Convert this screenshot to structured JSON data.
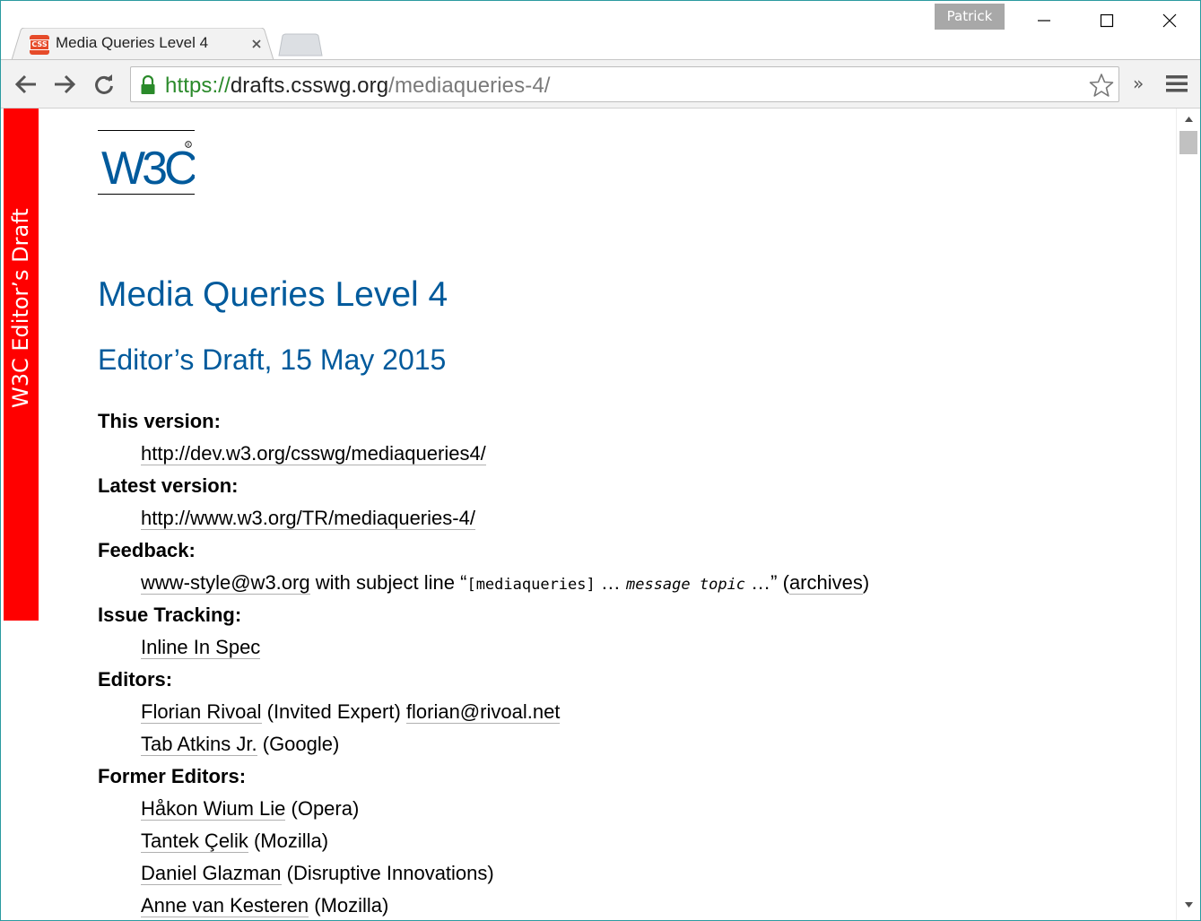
{
  "window": {
    "profile_name": "Patrick",
    "controls": {
      "minimize": "minimize-icon",
      "maximize": "maximize-icon",
      "close": "close-icon"
    }
  },
  "tabs": [
    {
      "favicon_text": "CSS",
      "title": "Media Queries Level 4",
      "active": true
    }
  ],
  "toolbar": {
    "url_scheme": "https://",
    "url_host": "drafts.csswg.org",
    "url_path": "/mediaqueries-4/",
    "extensions_label": "»"
  },
  "page": {
    "banner": "W3C Editor’s Draft",
    "logo_text": "W3C",
    "title": "Media Queries Level 4",
    "subtitle": "Editor’s Draft, 15 May 2015",
    "this_version_label": "This version:",
    "this_version_url": "http://dev.w3.org/csswg/mediaqueries4/",
    "latest_version_label": "Latest version:",
    "latest_version_url": "http://www.w3.org/TR/mediaqueries-4/",
    "feedback_label": "Feedback:",
    "feedback": {
      "email": "www-style@w3.org",
      "middle_text": " with subject line “",
      "subject_tag": "[mediaqueries]",
      "ellipsis": " … ",
      "topic": "message topic",
      "end_text": " …” (",
      "archives": "archives",
      "close_paren": ")"
    },
    "issue_tracking_label": "Issue Tracking:",
    "issue_tracking_link": "Inline In Spec",
    "editors_label": "Editors:",
    "editors": [
      {
        "name": "Florian Rivoal",
        "affiliation": " (Invited Expert) ",
        "email": "florian@rivoal.net"
      },
      {
        "name": "Tab Atkins Jr.",
        "affiliation": " (Google)"
      }
    ],
    "former_editors_label": "Former Editors:",
    "former_editors": [
      {
        "name": "Håkon Wium Lie",
        "affiliation": " (Opera)"
      },
      {
        "name": "Tantek Çelik",
        "affiliation": " (Mozilla)"
      },
      {
        "name": "Daniel Glazman",
        "affiliation": " (Disruptive Innovations)"
      },
      {
        "name": "Anne van Kesteren",
        "affiliation": " (Mozilla)"
      }
    ]
  },
  "colors": {
    "heading": "#005a9c",
    "banner": "#ff0000",
    "secure_scheme": "#2a8a2a",
    "window_border": "#2b9aa0"
  }
}
